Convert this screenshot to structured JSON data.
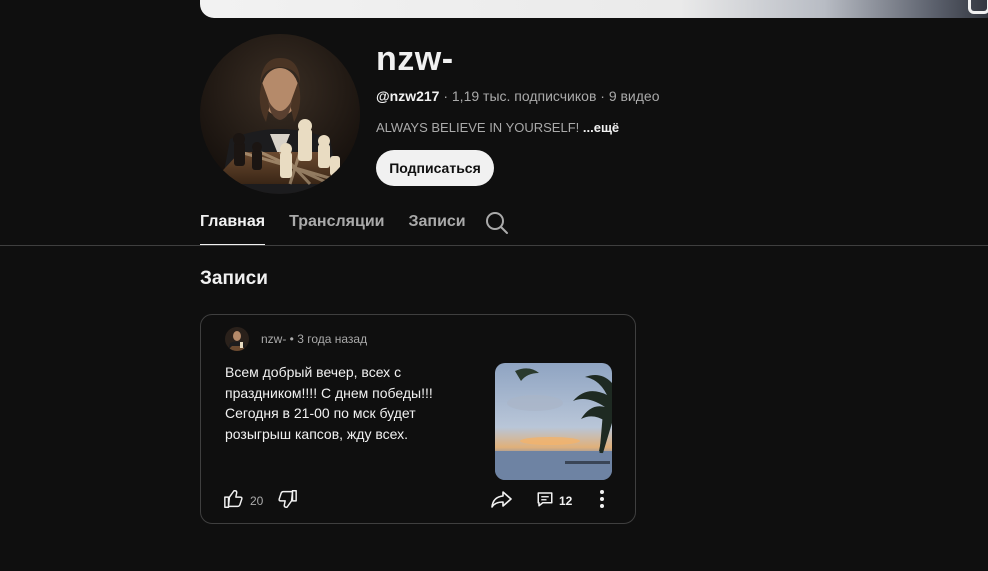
{
  "channel": {
    "name": "nzw-",
    "handle": "@nzw217",
    "stats": " · 1,19 тыс. подписчиков · 9 видео",
    "description": "ALWAYS BELIEVE IN YOURSELF!",
    "more_label": "...ещё",
    "subscribe_label": "Подписаться"
  },
  "tabs": [
    {
      "label": "Главная",
      "active": true
    },
    {
      "label": "Трансляции",
      "active": false
    },
    {
      "label": "Записи",
      "active": false
    }
  ],
  "section": {
    "title": "Записи"
  },
  "post": {
    "author": "nzw-",
    "time": " • 3 года назад",
    "text": "Всем добрый вечер, всех с праздником!!!! С днем победы!!! Сегодня в 21-00 по мск будет розыгрыш капсов, жду всех.",
    "likes": "20",
    "comments": "12"
  },
  "icons": {
    "search": "search-icon",
    "like": "thumbs-up-icon",
    "dislike": "thumbs-down-icon",
    "share": "share-icon",
    "comment": "comment-icon",
    "more": "more-vert-icon"
  },
  "colors": {
    "background": "#0f0f0f",
    "text": "#f1f1f1",
    "secondary_text": "#aaaaaa",
    "border": "#3f3f3f",
    "subscribe_bg": "#f1f1f1"
  }
}
